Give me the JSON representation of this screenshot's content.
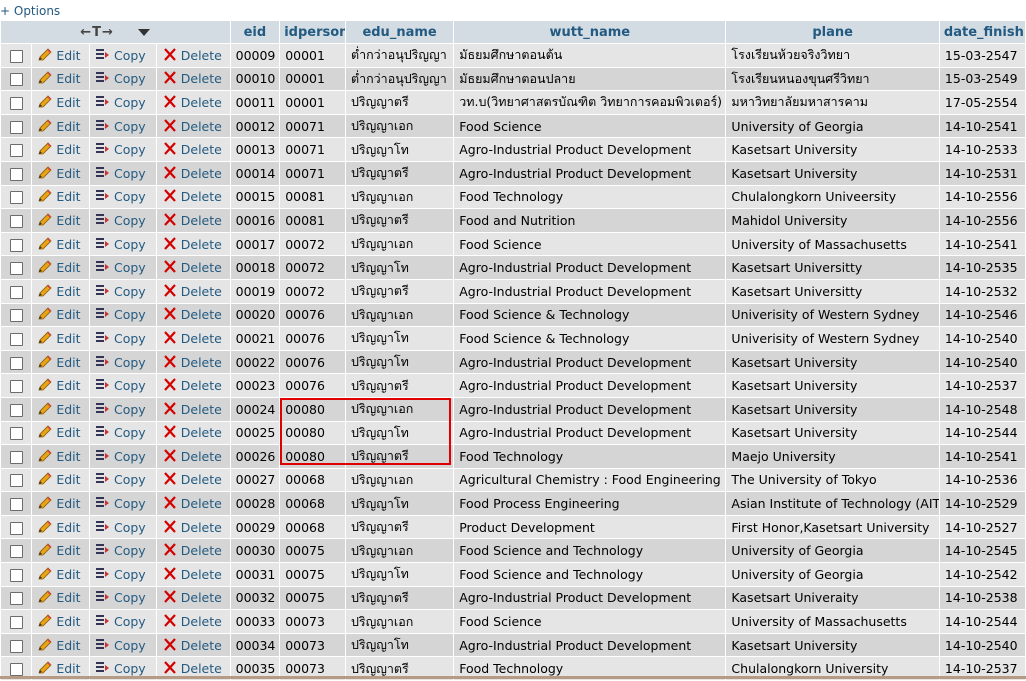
{
  "options_label": "+ Options",
  "header": {
    "sort_control": "←T→",
    "columns": [
      "eid",
      "idperson",
      "edu_name",
      "wutt_name",
      "plane",
      "date_finish"
    ]
  },
  "actions": {
    "edit": "Edit",
    "copy": "Copy",
    "delete": "Delete"
  },
  "highlight_color": "#e00000",
  "rows": [
    [
      "00009",
      "00001",
      "ต่ำกว่าอนุปริญญา",
      "มัธยมศึกษาตอนต้น",
      "โรงเรียนห้วยจริงวิทยา",
      "15-03-2547"
    ],
    [
      "00010",
      "00001",
      "ต่ำกว่าอนุปริญญา",
      "มัธยมศึกษาตอนปลาย",
      "โรงเรียนหนองขุนศรีวิทยา",
      "15-03-2549"
    ],
    [
      "00011",
      "00001",
      "ปริญญาตรี",
      "วท.บ(วิทยาศาสตรบัณฑิต วิทยาการคอมพิวเตอร์)",
      "มหาวิทยาลัยมหาสารคาม",
      "17-05-2554"
    ],
    [
      "00012",
      "00071",
      "ปริญญาเอก",
      "Food Science",
      "University of Georgia",
      "14-10-2541"
    ],
    [
      "00013",
      "00071",
      "ปริญญาโท",
      "Agro-Industrial Product Development",
      "Kasetsart University",
      "14-10-2533"
    ],
    [
      "00014",
      "00071",
      "ปริญญาตรี",
      "Agro-Industrial Product Development",
      "Kasetsart University",
      "14-10-2531"
    ],
    [
      "00015",
      "00081",
      "ปริญญาเอก",
      "Food Technology",
      "Chulalongkorn Univeersity",
      "14-10-2556"
    ],
    [
      "00016",
      "00081",
      "ปริญญาตรี",
      "Food and Nutrition",
      "Mahidol University",
      "14-10-2556"
    ],
    [
      "00017",
      "00072",
      "ปริญญาเอก",
      "Food Science",
      "University of Massachusetts",
      "14-10-2541"
    ],
    [
      "00018",
      "00072",
      "ปริญญาโท",
      "Agro-Industrial Product Development",
      "Kasetsart Universitty",
      "14-10-2535"
    ],
    [
      "00019",
      "00072",
      "ปริญญาตรี",
      "Agro-Industrial Product Development",
      "Kasetsart Universitty",
      "14-10-2532"
    ],
    [
      "00020",
      "00076",
      "ปริญญาเอก",
      "Food Science & Technology",
      "Univerisity of Western Sydney",
      "14-10-2546"
    ],
    [
      "00021",
      "00076",
      "ปริญญาโท",
      "Food Science & Technology",
      "Univerisity of Western Sydney",
      "14-10-2540"
    ],
    [
      "00022",
      "00076",
      "ปริญญาโท",
      "Agro-Industrial Product Development",
      "Kasetsart University",
      "14-10-2540"
    ],
    [
      "00023",
      "00076",
      "ปริญญาตรี",
      "Agro-Industrial Product Development",
      "Kasetsart University",
      "14-10-2537"
    ],
    [
      "00024",
      "00080",
      "ปริญญาเอก",
      "Agro-Industrial Product Development",
      "Kasetsart University",
      "14-10-2548"
    ],
    [
      "00025",
      "00080",
      "ปริญญาโท",
      "Agro-Industrial Product Development",
      "Kasetsart University",
      "14-10-2544"
    ],
    [
      "00026",
      "00080",
      "ปริญญาตรี",
      "Food Technology",
      "Maejo University",
      "14-10-2541"
    ],
    [
      "00027",
      "00068",
      "ปริญญาเอก",
      "Agricultural Chemistry : Food Engineering",
      "The University of Tokyo",
      "14-10-2536"
    ],
    [
      "00028",
      "00068",
      "ปริญญาโท",
      "Food Process Engineering",
      "Asian Institute of Technology (AIT)",
      "14-10-2529"
    ],
    [
      "00029",
      "00068",
      "ปริญญาตรี",
      "Product Development",
      "First Honor,Kasetsart University",
      "14-10-2527"
    ],
    [
      "00030",
      "00075",
      "ปริญญาเอก",
      "Food Science and Technology",
      "University of Georgia",
      "14-10-2545"
    ],
    [
      "00031",
      "00075",
      "ปริญญาโท",
      "Food Science and Technology",
      "University of Georgia",
      "14-10-2542"
    ],
    [
      "00032",
      "00075",
      "ปริญญาตรี",
      "Agro-Industrial Product Development",
      "Kasetsart Univeraity",
      "14-10-2538"
    ],
    [
      "00033",
      "00073",
      "ปริญญาเอก",
      "Food Science",
      "University of Massachusetts",
      "14-10-2544"
    ],
    [
      "00034",
      "00073",
      "ปริญญาโท",
      "Agro-Industrial Product Development",
      "Kasetsart University",
      "14-10-2540"
    ],
    [
      "00035",
      "00073",
      "ปริญญาตรี",
      "Food Technology",
      "Chulalongkorn University",
      "14-10-2537"
    ]
  ]
}
